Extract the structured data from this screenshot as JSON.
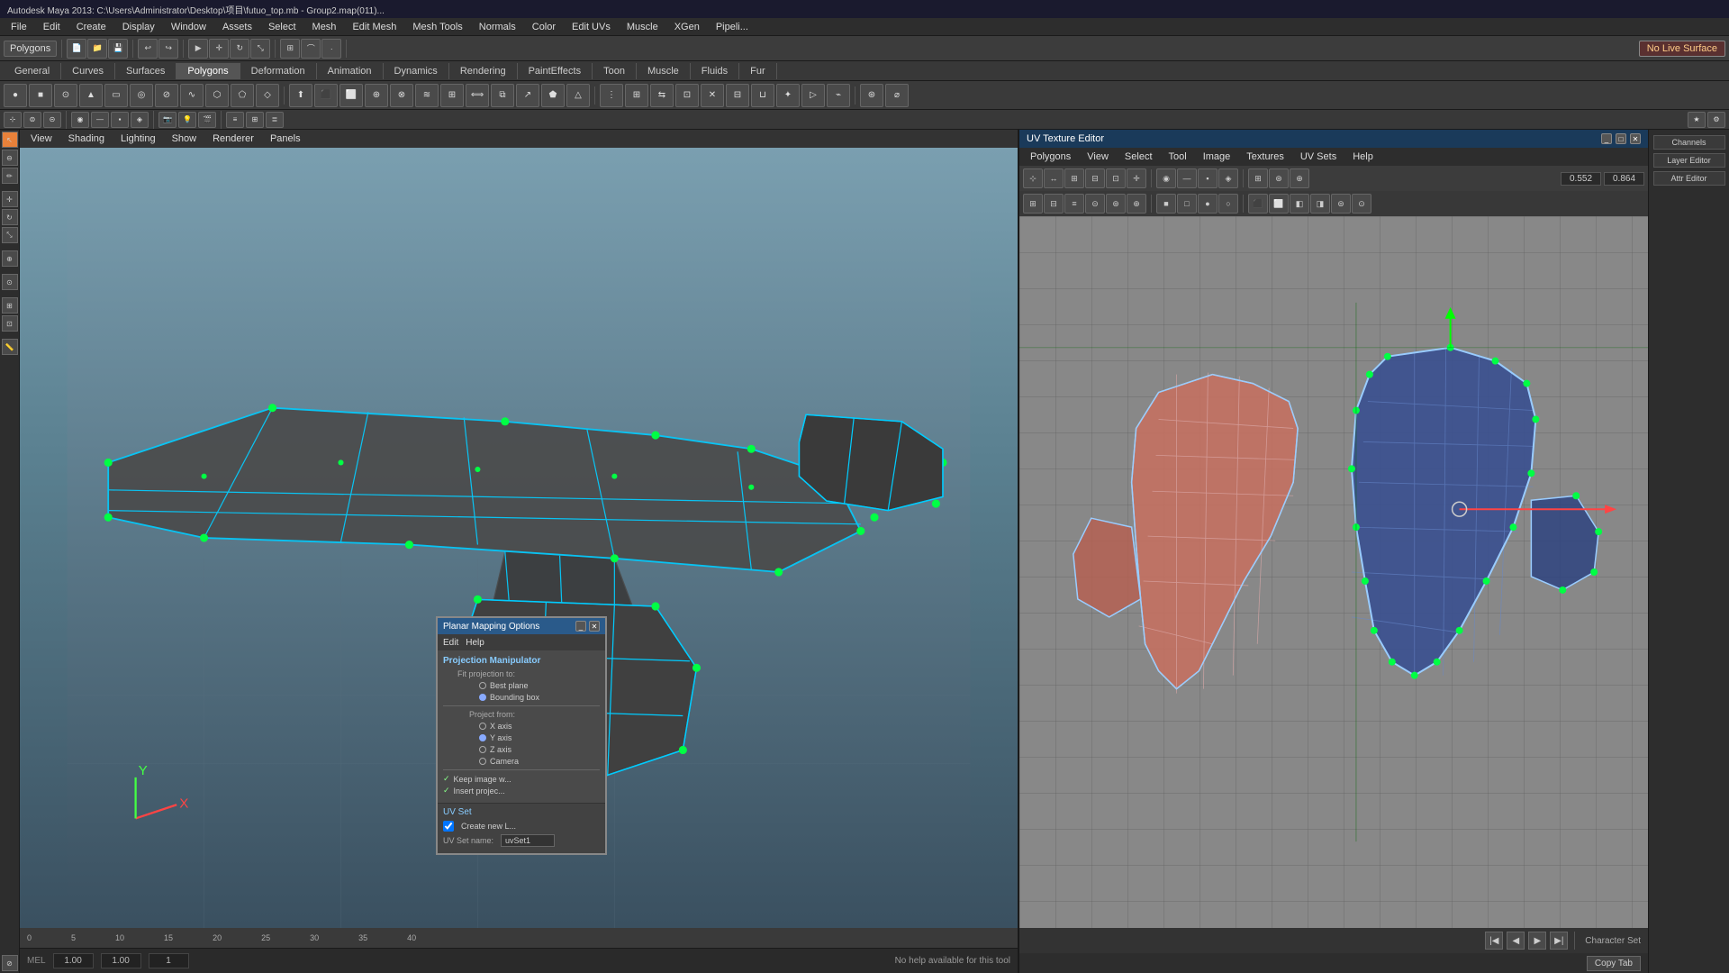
{
  "titlebar": {
    "text": "Autodesk Maya 2013: C:\\Users\\Administrator\\Desktop\\项目\\futuo_top.mb - Group2.map(011)..."
  },
  "menubar": {
    "items": [
      "File",
      "Edit",
      "Create",
      "Display",
      "Window",
      "Assets",
      "Select",
      "Mesh",
      "Edit Mesh",
      "Mesh Tools",
      "Normals",
      "Color",
      "Edit UVs",
      "Muscle",
      "XGen",
      "Pipeli..."
    ]
  },
  "toolbar1": {
    "mode_label": "Polygons",
    "no_live_surface": "No Live Surface"
  },
  "category_tabs": {
    "items": [
      "General",
      "Curves",
      "Surfaces",
      "Polygons",
      "Deformation",
      "Animation",
      "Dynamics",
      "Rendering",
      "PaintEffects",
      "Toon",
      "Muscle",
      "Fluids",
      "Fu..."
    ]
  },
  "viewport": {
    "menus": [
      "View",
      "Shading",
      "Lighting",
      "Show",
      "Renderer",
      "Panels"
    ],
    "grid_label": "No help available for this tool"
  },
  "uv_editor": {
    "title": "UV Texture Editor",
    "menus": [
      "Polygons",
      "View",
      "Select",
      "Tool",
      "Image",
      "Textures",
      "UV Sets",
      "Help"
    ],
    "value1": "0.552",
    "value2": "0.864",
    "bottom_label": "Copy Tab"
  },
  "planar_dialog": {
    "title": "Planar Mapping Options",
    "menu_items": [
      "Edit",
      "Help"
    ],
    "section": "Projection Manipulator",
    "fit_projection_label": "Fit projection to:",
    "fit_options": [
      "Best plane",
      "Bounding box"
    ],
    "fit_selected": 0,
    "project_from_label": "Project from:",
    "project_options": [
      "X axis",
      "Y axis",
      "Z axis",
      "Camera"
    ],
    "project_selected": 1,
    "checkboxes": [
      "Keep image w...",
      "Insert projec..."
    ],
    "uv_set_title": "UV Set",
    "create_new_label": "Create new L...",
    "uv_set_name_label": "UV Set name:",
    "uv_set_name_value": "uvSet1"
  },
  "timeline": {
    "ticks": [
      "0",
      "5",
      "10",
      "15",
      "20",
      "25",
      "30",
      "35",
      "40"
    ]
  },
  "status_bar": {
    "type": "MEL",
    "field1": "1.00",
    "field2": "1.00",
    "field3": "1",
    "message": "No help available for this tool"
  },
  "uv_playback": {
    "character_set": "Character Set"
  }
}
